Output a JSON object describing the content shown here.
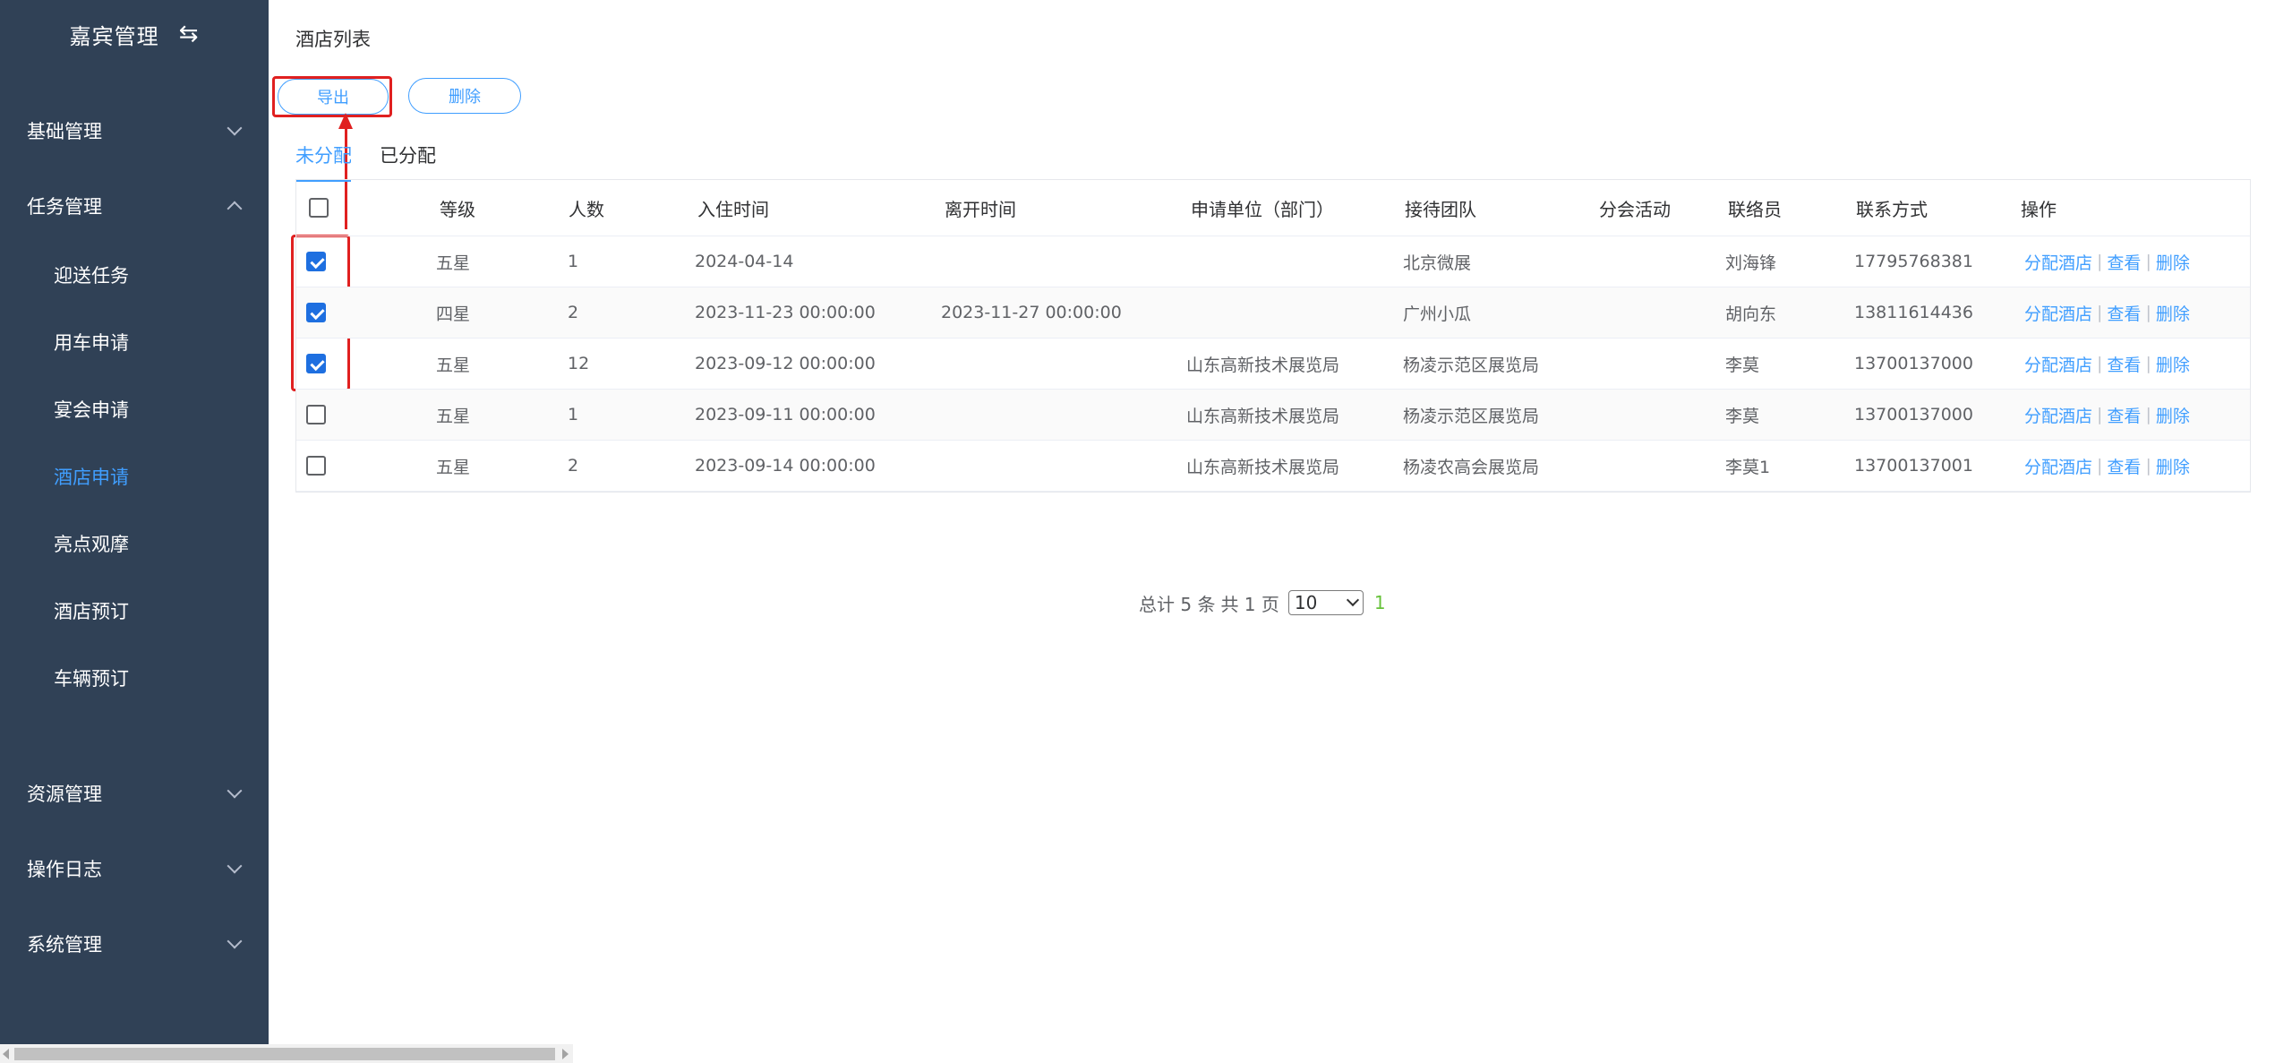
{
  "sidebar": {
    "title": "嘉宾管理",
    "toggle_icon": "swap-icon",
    "groups": [
      {
        "label": "基础管理",
        "expanded": false
      },
      {
        "label": "任务管理",
        "expanded": true
      },
      {
        "label": "资源管理",
        "expanded": false
      },
      {
        "label": "操作日志",
        "expanded": false
      },
      {
        "label": "系统管理",
        "expanded": false
      }
    ],
    "sub_items": [
      {
        "label": "迎送任务"
      },
      {
        "label": "用车申请"
      },
      {
        "label": "宴会申请"
      },
      {
        "label": "酒店申请",
        "active": true
      },
      {
        "label": "亮点观摩"
      },
      {
        "label": "酒店预订"
      },
      {
        "label": "车辆预订"
      }
    ]
  },
  "main": {
    "title": "酒店列表",
    "buttons": {
      "export": "导出",
      "delete": "删除"
    },
    "tabs": [
      {
        "label": "未分配",
        "active": true
      },
      {
        "label": "已分配",
        "active": false
      }
    ]
  },
  "table": {
    "headers": [
      "等级",
      "人数",
      "入住时间",
      "离开时间",
      "申请单位（部门）",
      "接待团队",
      "分会活动",
      "联络员",
      "联系方式",
      "操作"
    ],
    "rows": [
      {
        "checked": true,
        "level": "五星",
        "people": "1",
        "checkin": "2024-04-14",
        "checkout": "",
        "unit": "",
        "team": "北京微展",
        "activity": "",
        "contact": "刘海锋",
        "phone": "17795768381"
      },
      {
        "checked": true,
        "level": "四星",
        "people": "2",
        "checkin": "2023-11-23 00:00:00",
        "checkout": "2023-11-27 00:00:00",
        "unit": "",
        "team": "广州小瓜",
        "activity": "",
        "contact": "胡向东",
        "phone": "13811614436"
      },
      {
        "checked": true,
        "level": "五星",
        "people": "12",
        "checkin": "2023-09-12 00:00:00",
        "checkout": "",
        "unit": "山东高新技术展览局",
        "team": "杨凌示范区展览局",
        "activity": "",
        "contact": "李莫",
        "phone": "13700137000"
      },
      {
        "checked": false,
        "level": "五星",
        "people": "1",
        "checkin": "2023-09-11 00:00:00",
        "checkout": "",
        "unit": "山东高新技术展览局",
        "team": "杨凌示范区展览局",
        "activity": "",
        "contact": "李莫",
        "phone": "13700137000"
      },
      {
        "checked": false,
        "level": "五星",
        "people": "2",
        "checkin": "2023-09-14 00:00:00",
        "checkout": "",
        "unit": "山东高新技术展览局",
        "team": "杨凌农高会展览局",
        "activity": "",
        "contact": "李莫1",
        "phone": "13700137001"
      }
    ],
    "actions": [
      "分配酒店",
      "查看",
      "删除"
    ],
    "action_sep": "|"
  },
  "pagination": {
    "total_text": "总计 5 条",
    "pages_text": "共 1 页",
    "page_size": "10",
    "current_page": "1"
  },
  "colors": {
    "sidebar_bg": "#304156",
    "accent": "#409eff",
    "highlight": "#e02020",
    "current_page": "#67c23a"
  }
}
